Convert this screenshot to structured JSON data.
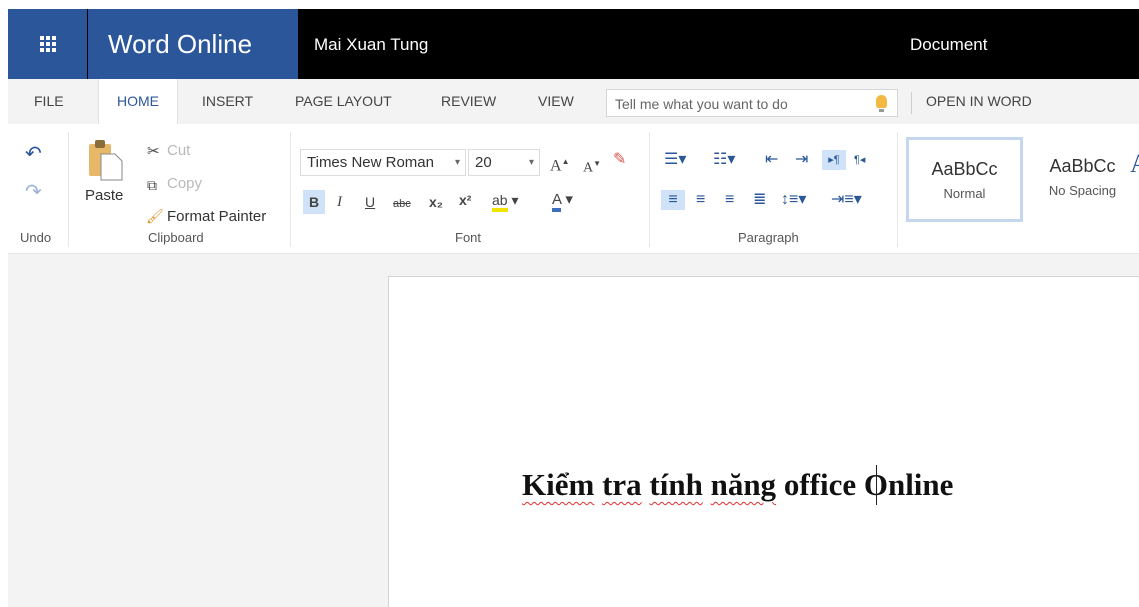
{
  "titlebar": {
    "app_name": "Word Online",
    "user_name": "Mai Xuan Tung",
    "document_name": "Document",
    "app_color": "#2b579a"
  },
  "tabs": [
    "FILE",
    "HOME",
    "INSERT",
    "PAGE LAYOUT",
    "REVIEW",
    "VIEW"
  ],
  "active_tab": "HOME",
  "tell_me": {
    "placeholder": "Tell me what you want to do",
    "icon": "lightbulb-icon"
  },
  "open_in_word": "OPEN IN WORD",
  "ribbon": {
    "undo_group": {
      "label": "Undo"
    },
    "clipboard": {
      "label": "Clipboard",
      "paste": "Paste",
      "cut": "Cut",
      "copy": "Copy",
      "format_painter": "Format Painter"
    },
    "font": {
      "label": "Font",
      "font_name": "Times New Roman",
      "font_size": "20",
      "bold": "B",
      "italic": "I",
      "underline": "U",
      "strike": "abc",
      "subscript": "x₂",
      "superscript": "x²",
      "font_color": "A",
      "grow": "A",
      "shrink": "A"
    },
    "paragraph": {
      "label": "Paragraph"
    },
    "styles": [
      {
        "sample": "AaBbCc",
        "name": "Normal"
      },
      {
        "sample": "AaBbCc",
        "name": "No Spacing"
      }
    ]
  },
  "document": {
    "parts": [
      "Kiểm",
      " ",
      "tra",
      " ",
      "tính",
      " ",
      "năng",
      " office Online"
    ]
  }
}
